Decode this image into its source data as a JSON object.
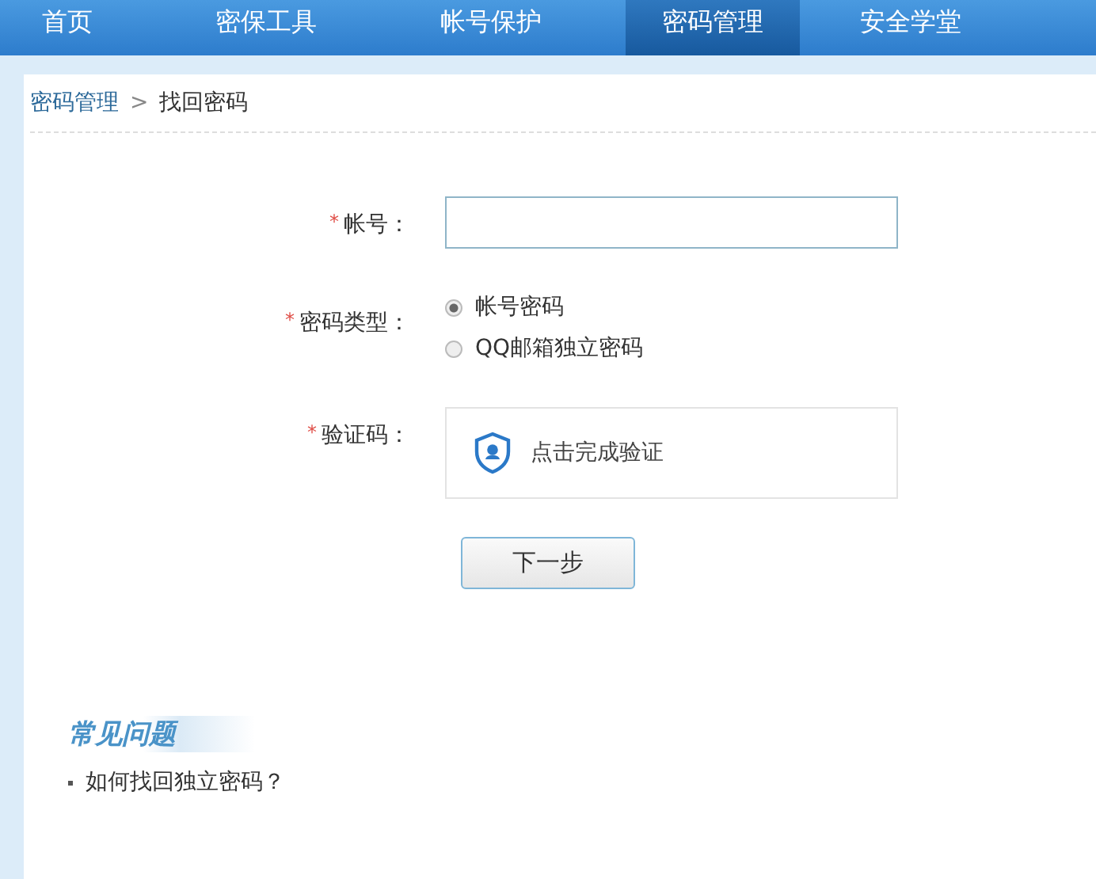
{
  "nav": [
    {
      "label": "首页",
      "selected": false
    },
    {
      "label": "密保工具",
      "selected": false
    },
    {
      "label": "帐号保护",
      "selected": false
    },
    {
      "label": "密码管理",
      "selected": true
    },
    {
      "label": "安全学堂",
      "selected": false
    }
  ],
  "breadcrumb": {
    "parent": "密码管理",
    "separator": ">",
    "current": "找回密码"
  },
  "form": {
    "fields": [
      {
        "kind": "input",
        "required_mark": "*",
        "label": "帐号："
      },
      {
        "kind": "radio",
        "required_mark": "*",
        "label": "密码类型：",
        "options": [
          {
            "label": "帐号密码",
            "selected": true
          },
          {
            "label": "QQ邮箱独立密码",
            "selected": false
          }
        ]
      },
      {
        "kind": "captcha",
        "required_mark": "*",
        "label": "验证码：",
        "text": "点击完成验证"
      }
    ],
    "submit": "下一步"
  },
  "faq": {
    "title": "常见问题",
    "items": [
      "如何找回独立密码？"
    ]
  }
}
